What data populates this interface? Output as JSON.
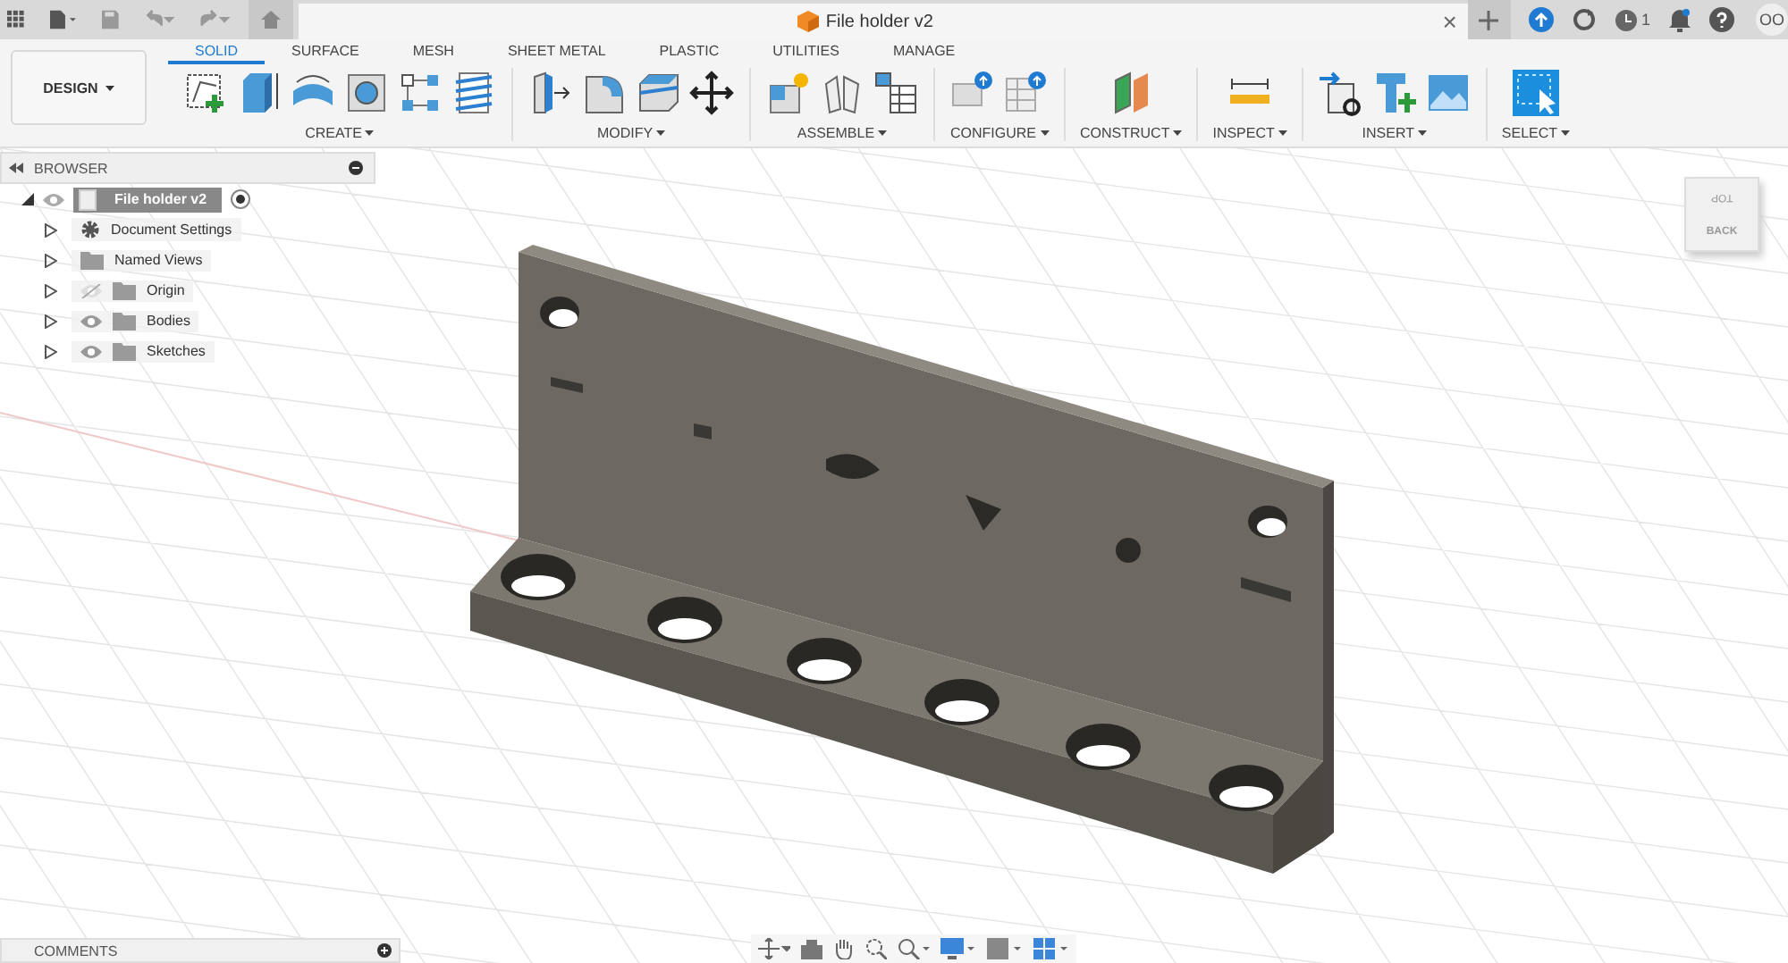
{
  "top_bar": {
    "notification_count": "1",
    "avatar": "OO"
  },
  "document_tab": {
    "title": "File holder v2",
    "close": "×"
  },
  "workspace": {
    "label": "DESIGN"
  },
  "ribbon_tabs": [
    {
      "label": "SOLID",
      "selected": true
    },
    {
      "label": "SURFACE",
      "selected": false
    },
    {
      "label": "MESH",
      "selected": false
    },
    {
      "label": "SHEET METAL",
      "selected": false
    },
    {
      "label": "PLASTIC",
      "selected": false
    },
    {
      "label": "UTILITIES",
      "selected": false
    },
    {
      "label": "MANAGE",
      "selected": false
    }
  ],
  "groups": [
    {
      "label": "CREATE",
      "tools": [
        {
          "kind": "sketch"
        },
        {
          "kind": "extrude"
        },
        {
          "kind": "revolve"
        },
        {
          "kind": "hole"
        },
        {
          "kind": "pattern"
        },
        {
          "kind": "thread"
        }
      ]
    },
    {
      "label": "MODIFY",
      "tools": [
        {
          "kind": "presspull"
        },
        {
          "kind": "fillet"
        },
        {
          "kind": "shell"
        },
        {
          "kind": "move"
        }
      ]
    },
    {
      "label": "ASSEMBLE",
      "tools": [
        {
          "kind": "component"
        },
        {
          "kind": "joint"
        },
        {
          "kind": "table"
        }
      ]
    },
    {
      "label": "CONFIGURE",
      "tools": [
        {
          "kind": "config"
        },
        {
          "kind": "configtable"
        }
      ]
    },
    {
      "label": "CONSTRUCT",
      "tools": [
        {
          "kind": "plane"
        }
      ]
    },
    {
      "label": "INSPECT",
      "tools": [
        {
          "kind": "measure"
        }
      ]
    },
    {
      "label": "INSERT",
      "tools": [
        {
          "kind": "insertlink"
        },
        {
          "kind": "fastener"
        },
        {
          "kind": "image"
        }
      ]
    },
    {
      "label": "SELECT",
      "tools": [
        {
          "kind": "select"
        }
      ]
    }
  ],
  "browser": {
    "title": "BROWSER",
    "root": {
      "label": "File holder v2",
      "expanded": true,
      "visible": true,
      "active": true,
      "children": [
        {
          "label": "Document Settings",
          "kind": "settings",
          "expanded": false
        },
        {
          "label": "Named Views",
          "kind": "folder",
          "expanded": false
        },
        {
          "label": "Origin",
          "kind": "folder",
          "expanded": false,
          "visible": false
        },
        {
          "label": "Bodies",
          "kind": "folder",
          "expanded": false,
          "visible": true
        },
        {
          "label": "Sketches",
          "kind": "folder",
          "expanded": false,
          "visible": true
        }
      ]
    }
  },
  "viewcube": {
    "top": "TOP",
    "front": "BACK"
  },
  "comments": {
    "label": "COMMENTS"
  }
}
